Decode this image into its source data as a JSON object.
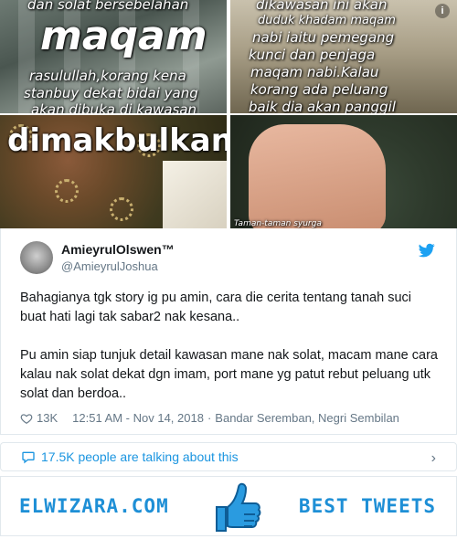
{
  "media": {
    "tile1": {
      "top_line": "dan solat bersebelahan",
      "headline": "maqam",
      "line1": "rasulullah,korang kena",
      "line2": "stanbuy dekat bidai yang",
      "line3": "akan dibuka di kawasan"
    },
    "tile2": {
      "line1": "dikawasan ini akan",
      "line2": "duduk khadam maqam",
      "line3": "nabi iaitu pemegang",
      "line4": "kunci dan penjaga",
      "line5": "maqam nabi.Kalau",
      "line6": "korang ada peluang",
      "line7": "baik dia akan panggil"
    },
    "tile3": {
      "headline": "dimakbulkan"
    },
    "tile4": {
      "caption": "Taman-taman syurga"
    },
    "info_icon": "info-icon"
  },
  "tweet": {
    "name": "AmieyrulOlswen™",
    "handle": "@AmieyrulJoshua",
    "paragraph1": "Bahagianya tgk story ig pu amin, cara die cerita tentang tanah suci buat hati lagi tak sabar2 nak kesana..",
    "paragraph2": "Pu amin siap tunjuk detail kawasan mane nak solat, macam mane cara kalau nak solat dekat dgn imam, port mane yg patut rebut peluang utk solat dan berdoa..",
    "likes": "13K",
    "timestamp": "12:51 AM - Nov 14, 2018",
    "separator": "·",
    "location": "Bandar Seremban, Negri Sembilan"
  },
  "talking": {
    "label": "17.5K people are talking about this"
  },
  "banner": {
    "brand": "ELWIZARA.COM",
    "best": "BEST TWEETS"
  },
  "colors": {
    "twitter_blue": "#1da1f2",
    "link_blue": "#1b95e0",
    "brand_blue": "#1e8fd6",
    "muted": "#657786"
  }
}
